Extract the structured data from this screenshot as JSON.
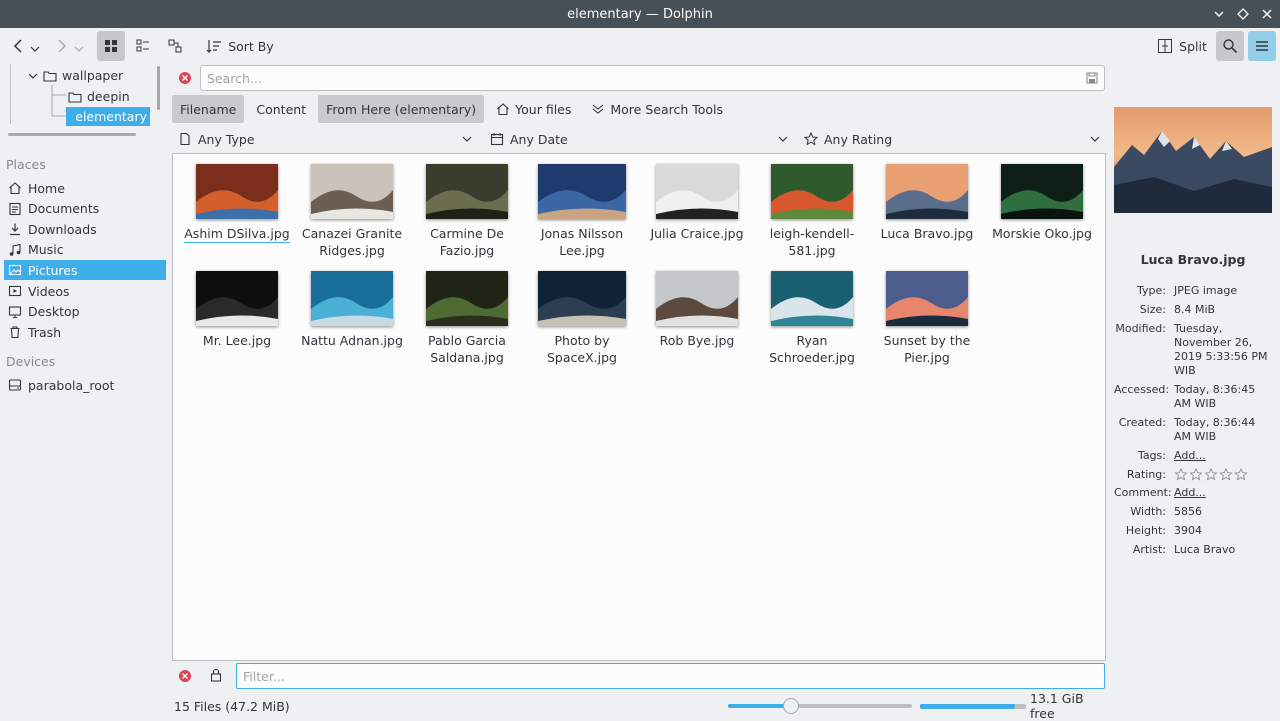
{
  "window": {
    "title": "elementary — Dolphin"
  },
  "toolbar": {
    "sort_label": "Sort By",
    "split_label": "Split"
  },
  "tree": [
    {
      "label": "wallpaper"
    },
    {
      "label": "deepin"
    },
    {
      "label": "elementary"
    }
  ],
  "places": {
    "heading": "Places",
    "items": [
      {
        "label": "Home",
        "icon": "home-icon"
      },
      {
        "label": "Documents",
        "icon": "documents-icon"
      },
      {
        "label": "Downloads",
        "icon": "downloads-icon"
      },
      {
        "label": "Music",
        "icon": "music-icon"
      },
      {
        "label": "Pictures",
        "icon": "pictures-icon"
      },
      {
        "label": "Videos",
        "icon": "videos-icon"
      },
      {
        "label": "Desktop",
        "icon": "desktop-icon"
      },
      {
        "label": "Trash",
        "icon": "trash-icon"
      }
    ],
    "selected": "Pictures"
  },
  "devices": {
    "heading": "Devices",
    "items": [
      {
        "label": "parabola_root"
      }
    ]
  },
  "search": {
    "placeholder": "Search...",
    "tabs": [
      {
        "label": "Filename",
        "active": true
      },
      {
        "label": "Content",
        "active": false
      },
      {
        "label": "From Here (elementary)",
        "active": true
      },
      {
        "label": "Your files",
        "active": false
      },
      {
        "label": "More Search Tools",
        "active": false
      }
    ],
    "type": "Any Type",
    "date": "Any Date",
    "rating": "Any Rating"
  },
  "files": [
    {
      "name": "Ashim DSilva.jpg",
      "colors": [
        "#7b2e1c",
        "#d35f2c",
        "#3d6fa8"
      ]
    },
    {
      "name": "Canazei Granite Ridges.jpg",
      "colors": [
        "#c9c3bb",
        "#6d5e52",
        "#e8e6e3"
      ]
    },
    {
      "name": "Carmine De Fazio.jpg",
      "colors": [
        "#3a3d2e",
        "#6b6d4f",
        "#1f2119"
      ]
    },
    {
      "name": "Jonas Nilsson Lee.jpg",
      "colors": [
        "#1e3a6e",
        "#3b68a4",
        "#c9a483"
      ]
    },
    {
      "name": "Julia Craice.jpg",
      "colors": [
        "#d9d9d9",
        "#f0f0f0",
        "#222222"
      ]
    },
    {
      "name": "leigh-kendell-581.jpg",
      "colors": [
        "#2f5a2e",
        "#d7582e",
        "#5e8a3d"
      ]
    },
    {
      "name": "Luca Bravo.jpg",
      "colors": [
        "#e8a072",
        "#5a6e8c",
        "#1e2b3d"
      ]
    },
    {
      "name": "Morskie Oko.jpg",
      "colors": [
        "#0f1f17",
        "#2f6e3e",
        "#0a140e"
      ]
    },
    {
      "name": "Mr. Lee.jpg",
      "colors": [
        "#0e0e0e",
        "#2a2a2a",
        "#e8e8e8"
      ]
    },
    {
      "name": "Nattu Adnan.jpg",
      "colors": [
        "#1a6f9a",
        "#4bb0d6",
        "#c7dbe6"
      ]
    },
    {
      "name": "Pablo Garcia Saldana.jpg",
      "colors": [
        "#1f2416",
        "#4e6b33",
        "#2a2f1e"
      ]
    },
    {
      "name": "Photo by SpaceX.jpg",
      "colors": [
        "#0f2236",
        "#2d3e52",
        "#c8c0b1"
      ]
    },
    {
      "name": "Rob Bye.jpg",
      "colors": [
        "#c4c8cb",
        "#5b4a3d",
        "#e0e1e0"
      ]
    },
    {
      "name": "Ryan Schroeder.jpg",
      "colors": [
        "#1b5f73",
        "#d9e5ea",
        "#2f8497"
      ]
    },
    {
      "name": "Sunset by the Pier.jpg",
      "colors": [
        "#4c5c8c",
        "#e8866b",
        "#1a2b3f"
      ]
    }
  ],
  "filter": {
    "placeholder": "Filter..."
  },
  "status": {
    "count": "15 Files (47.2 MiB)",
    "zoom": 0.34,
    "disk_used": 0.9,
    "free": "13.1 GiB free"
  },
  "info": {
    "title": "Luca Bravo.jpg",
    "rows": [
      {
        "key": "Type:",
        "value": "JPEG image"
      },
      {
        "key": "Size:",
        "value": "8.4 MiB"
      },
      {
        "key": "Modified:",
        "value": "Tuesday, November 26, 2019 5:33:56 PM WIB"
      },
      {
        "key": "Accessed:",
        "value": "Today, 8:36:45 AM WIB"
      },
      {
        "key": "Created:",
        "value": "Today, 8:36:44 AM WIB"
      },
      {
        "key": "Tags:",
        "value": "Add..."
      },
      {
        "key": "Rating:",
        "value": ""
      },
      {
        "key": "Comment:",
        "value": "Add..."
      },
      {
        "key": "Width:",
        "value": "5856"
      },
      {
        "key": "Height:",
        "value": "3904"
      },
      {
        "key": "Artist:",
        "value": "Luca Bravo"
      }
    ],
    "rating_stars": 0
  },
  "colors": {
    "accent": "#3daee9",
    "titlebar": "#475057",
    "window_bg": "#eff0f1",
    "view_bg": "#fcfcfc",
    "close_red": "#da4453"
  }
}
